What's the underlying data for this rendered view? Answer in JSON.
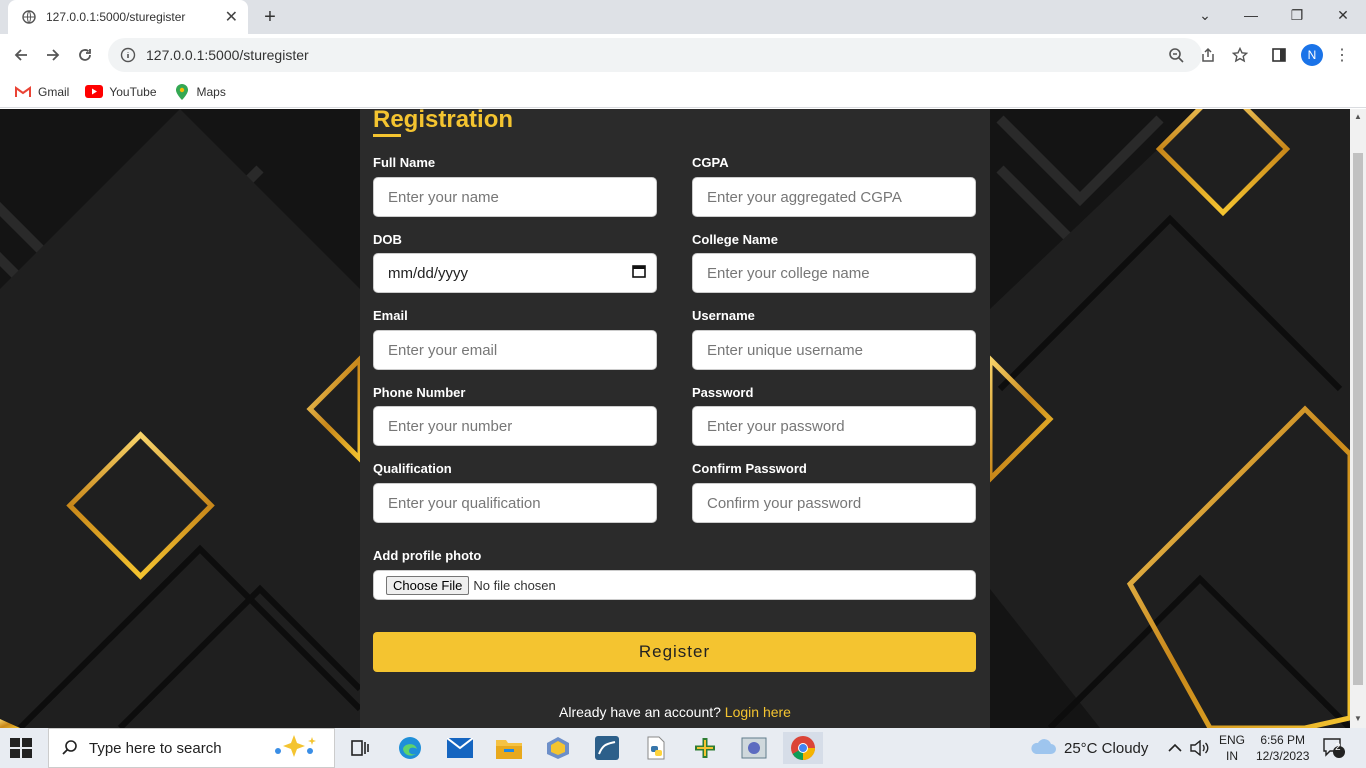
{
  "browser": {
    "tab_title": "127.0.0.1:5000/sturegister",
    "url": "127.0.0.1:5000/sturegister",
    "profile_initial": "N",
    "bookmarks": [
      {
        "label": "Gmail"
      },
      {
        "label": "YouTube"
      },
      {
        "label": "Maps"
      }
    ]
  },
  "form": {
    "heading": "Registration",
    "fields": {
      "full_name": {
        "label": "Full Name",
        "placeholder": "Enter your name"
      },
      "cgpa": {
        "label": "CGPA",
        "placeholder": "Enter your aggregated CGPA"
      },
      "dob": {
        "label": "DOB",
        "value": "mm/dd/yyyy"
      },
      "college": {
        "label": "College Name",
        "placeholder": "Enter your college name"
      },
      "email": {
        "label": "Email",
        "placeholder": "Enter your email"
      },
      "username": {
        "label": "Username",
        "placeholder": "Enter unique username"
      },
      "phone": {
        "label": "Phone Number",
        "placeholder": "Enter your number"
      },
      "password": {
        "label": "Password",
        "placeholder": "Enter your password"
      },
      "qualification": {
        "label": "Qualification",
        "placeholder": "Enter your qualification"
      },
      "confirm_password": {
        "label": "Confirm Password",
        "placeholder": "Confirm your password"
      }
    },
    "photo": {
      "label": "Add profile photo",
      "button": "Choose File",
      "status": "No file chosen"
    },
    "submit_label": "Register",
    "login_prompt": "Already have an account?",
    "login_link": "Login here"
  },
  "taskbar": {
    "search_placeholder": "Type here to search",
    "weather": "25°C  Cloudy",
    "lang_top": "ENG",
    "lang_bottom": "IN",
    "time": "6:56 PM",
    "date": "12/3/2023",
    "notification_count": "2"
  },
  "colors": {
    "accent": "#f4c430",
    "card": "#2b2b2b"
  }
}
